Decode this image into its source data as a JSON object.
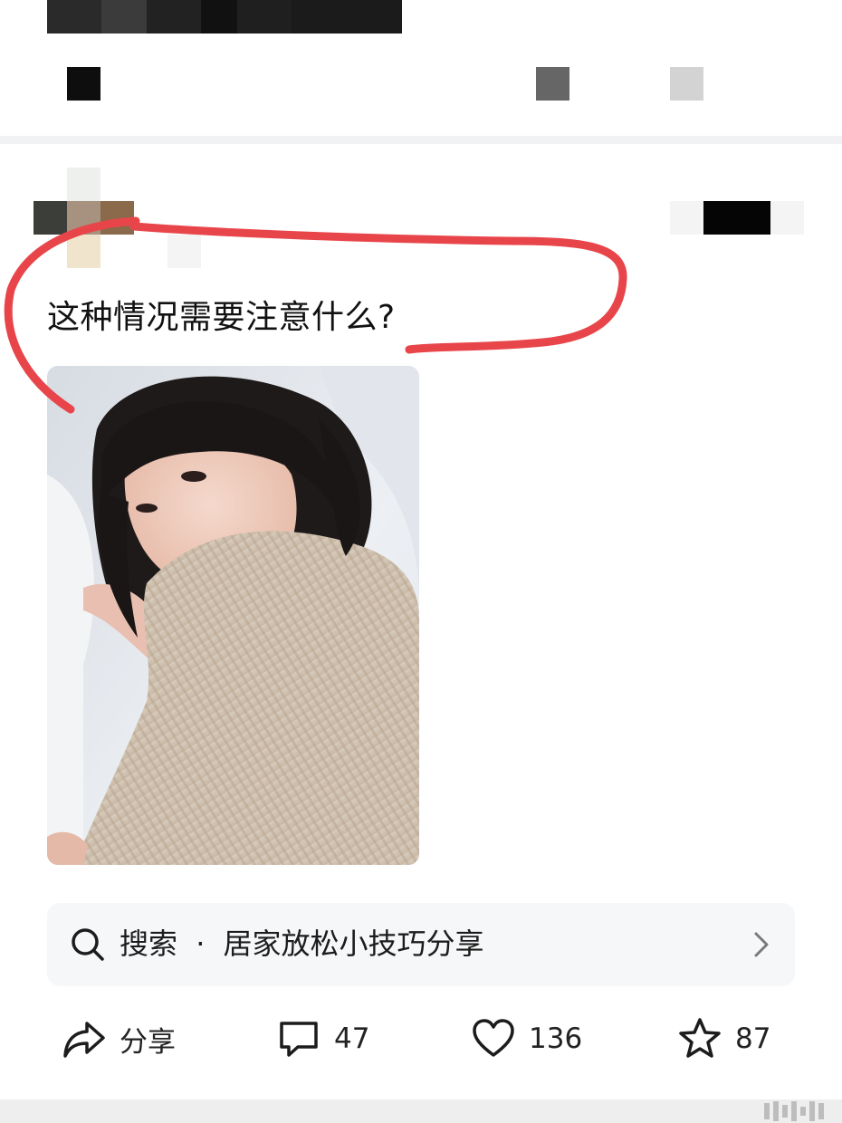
{
  "post": {
    "title": "这种情况需要注意什么?"
  },
  "search": {
    "label": "搜索",
    "separator": "·",
    "query": "居家放松小技巧分享"
  },
  "actions": {
    "share_label": "分享",
    "comments": "47",
    "likes": "136",
    "favorites": "87"
  },
  "colors": {
    "annotation": "#e8454a",
    "search_bg": "#f5f7f9",
    "divider": "#f1f2f4"
  },
  "icons": [
    "search-icon",
    "chevron-right-icon",
    "share-icon",
    "comment-icon",
    "heart-icon",
    "star-icon"
  ]
}
